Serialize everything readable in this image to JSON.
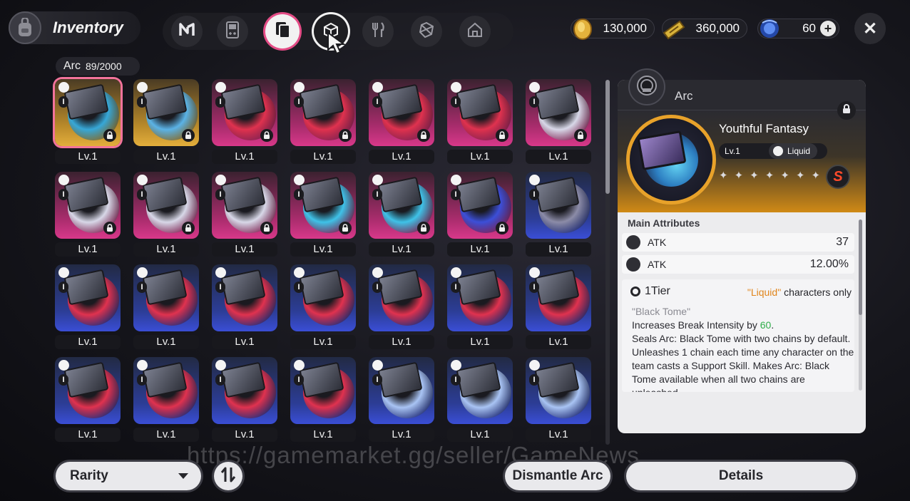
{
  "header": {
    "title": "Inventory",
    "tabs": [
      {
        "name": "tab-n",
        "icon": "n-logo-icon"
      },
      {
        "name": "tab-device",
        "icon": "gameboy-icon"
      },
      {
        "name": "tab-arc",
        "icon": "arc-card-icon",
        "active": true
      },
      {
        "name": "tab-box",
        "icon": "box-icon",
        "hover": true
      },
      {
        "name": "tab-food",
        "icon": "fork-knife-icon"
      },
      {
        "name": "tab-material",
        "icon": "cube-icon"
      },
      {
        "name": "tab-home",
        "icon": "home-icon"
      }
    ],
    "currencies": [
      {
        "name": "gold-coin",
        "value": "130,000",
        "icon": "coin-icon",
        "color": "#e3b23c"
      },
      {
        "name": "ticket",
        "value": "360,000",
        "icon": "ticket-icon",
        "color": "#d8b23a"
      },
      {
        "name": "crystal",
        "value": "60",
        "icon": "blue-orb-icon",
        "color": "#3d6ee0"
      }
    ],
    "close_label": "✕"
  },
  "collection": {
    "label": "Arc",
    "count": "89/2000"
  },
  "cards": [
    {
      "lv": "Lv.1",
      "frame": "gold",
      "locked": true,
      "selected": true,
      "disc": "#37a8d8"
    },
    {
      "lv": "Lv.1",
      "frame": "gold",
      "locked": true,
      "disc": "#5bb3e6"
    },
    {
      "lv": "Lv.1",
      "frame": "pink",
      "locked": true,
      "disc": "#e0324f"
    },
    {
      "lv": "Lv.1",
      "frame": "pink",
      "locked": true,
      "disc": "#e0324f"
    },
    {
      "lv": "Lv.1",
      "frame": "pink",
      "locked": true,
      "disc": "#e0324f"
    },
    {
      "lv": "Lv.1",
      "frame": "pink",
      "locked": true,
      "disc": "#e0324f"
    },
    {
      "lv": "Lv.1",
      "frame": "pink",
      "locked": true,
      "disc": "#d8d8e8"
    },
    {
      "lv": "Lv.1",
      "frame": "pink",
      "locked": true,
      "disc": "#d8d8e8"
    },
    {
      "lv": "Lv.1",
      "frame": "pink",
      "locked": true,
      "disc": "#d8d8e8"
    },
    {
      "lv": "Lv.1",
      "frame": "pink",
      "locked": true,
      "disc": "#d8d8e8"
    },
    {
      "lv": "Lv.1",
      "frame": "pink",
      "locked": true,
      "disc": "#3fc2e8"
    },
    {
      "lv": "Lv.1",
      "frame": "pink",
      "locked": true,
      "disc": "#3fc2e8"
    },
    {
      "lv": "Lv.1",
      "frame": "pink",
      "locked": true,
      "disc": "#3c4fd8"
    },
    {
      "lv": "Lv.1",
      "frame": "blue",
      "locked": false,
      "disc": "#8c8ca8"
    },
    {
      "lv": "Lv.1",
      "frame": "blue",
      "locked": false,
      "disc": "#e0324f"
    },
    {
      "lv": "Lv.1",
      "frame": "blue",
      "locked": false,
      "disc": "#e0324f"
    },
    {
      "lv": "Lv.1",
      "frame": "blue",
      "locked": false,
      "disc": "#e0324f"
    },
    {
      "lv": "Lv.1",
      "frame": "blue",
      "locked": false,
      "disc": "#e0324f"
    },
    {
      "lv": "Lv.1",
      "frame": "blue",
      "locked": false,
      "disc": "#e0324f"
    },
    {
      "lv": "Lv.1",
      "frame": "blue",
      "locked": false,
      "disc": "#e0324f"
    },
    {
      "lv": "Lv.1",
      "frame": "blue",
      "locked": false,
      "disc": "#e0324f"
    },
    {
      "lv": "Lv.1",
      "frame": "blue",
      "locked": false,
      "disc": "#e0324f"
    },
    {
      "lv": "Lv.1",
      "frame": "blue",
      "locked": false,
      "disc": "#e0324f"
    },
    {
      "lv": "Lv.1",
      "frame": "blue",
      "locked": false,
      "disc": "#e0324f"
    },
    {
      "lv": "Lv.1",
      "frame": "blue",
      "locked": false,
      "disc": "#e0324f"
    },
    {
      "lv": "Lv.1",
      "frame": "blue",
      "locked": false,
      "disc": "#a9c4f4"
    },
    {
      "lv": "Lv.1",
      "frame": "blue",
      "locked": false,
      "disc": "#a9c4f4"
    },
    {
      "lv": "Lv.1",
      "frame": "blue",
      "locked": false,
      "disc": "#a9c4f4"
    }
  ],
  "detail": {
    "category": "Arc",
    "name": "Youthful Fantasy",
    "level": "Lv.1",
    "element": "Liquid",
    "stars": [
      "✦",
      "✦",
      "✦",
      "✦",
      "✦",
      "✦",
      "✦"
    ],
    "rank": "S",
    "main_attributes_title": "Main Attributes",
    "attributes": [
      {
        "label": "ATK",
        "value": "37"
      },
      {
        "label": "ATK",
        "value": "12.00%"
      }
    ],
    "skill": {
      "tier": "1Tier",
      "requirement_pre": "",
      "requirement_element": "\"Liquid\"",
      "requirement_post": "characters only",
      "name": "\"Black Tome\"",
      "line1_pre": "Increases Break Intensity by",
      "line1_value": "60",
      "line1_post": ".",
      "line2": "Seals Arc: Black Tome with two chains by default. Unleashes 1 chain each time any character on the team casts a Support Skill. Makes Arc: Black Tome available when all two chains are unleashed."
    }
  },
  "footer": {
    "sort_label": "Rarity",
    "dismantle_label": "Dismantle Arc",
    "details_label": "Details"
  },
  "watermark": "https://gamemarket.gg/seller/GameNews"
}
